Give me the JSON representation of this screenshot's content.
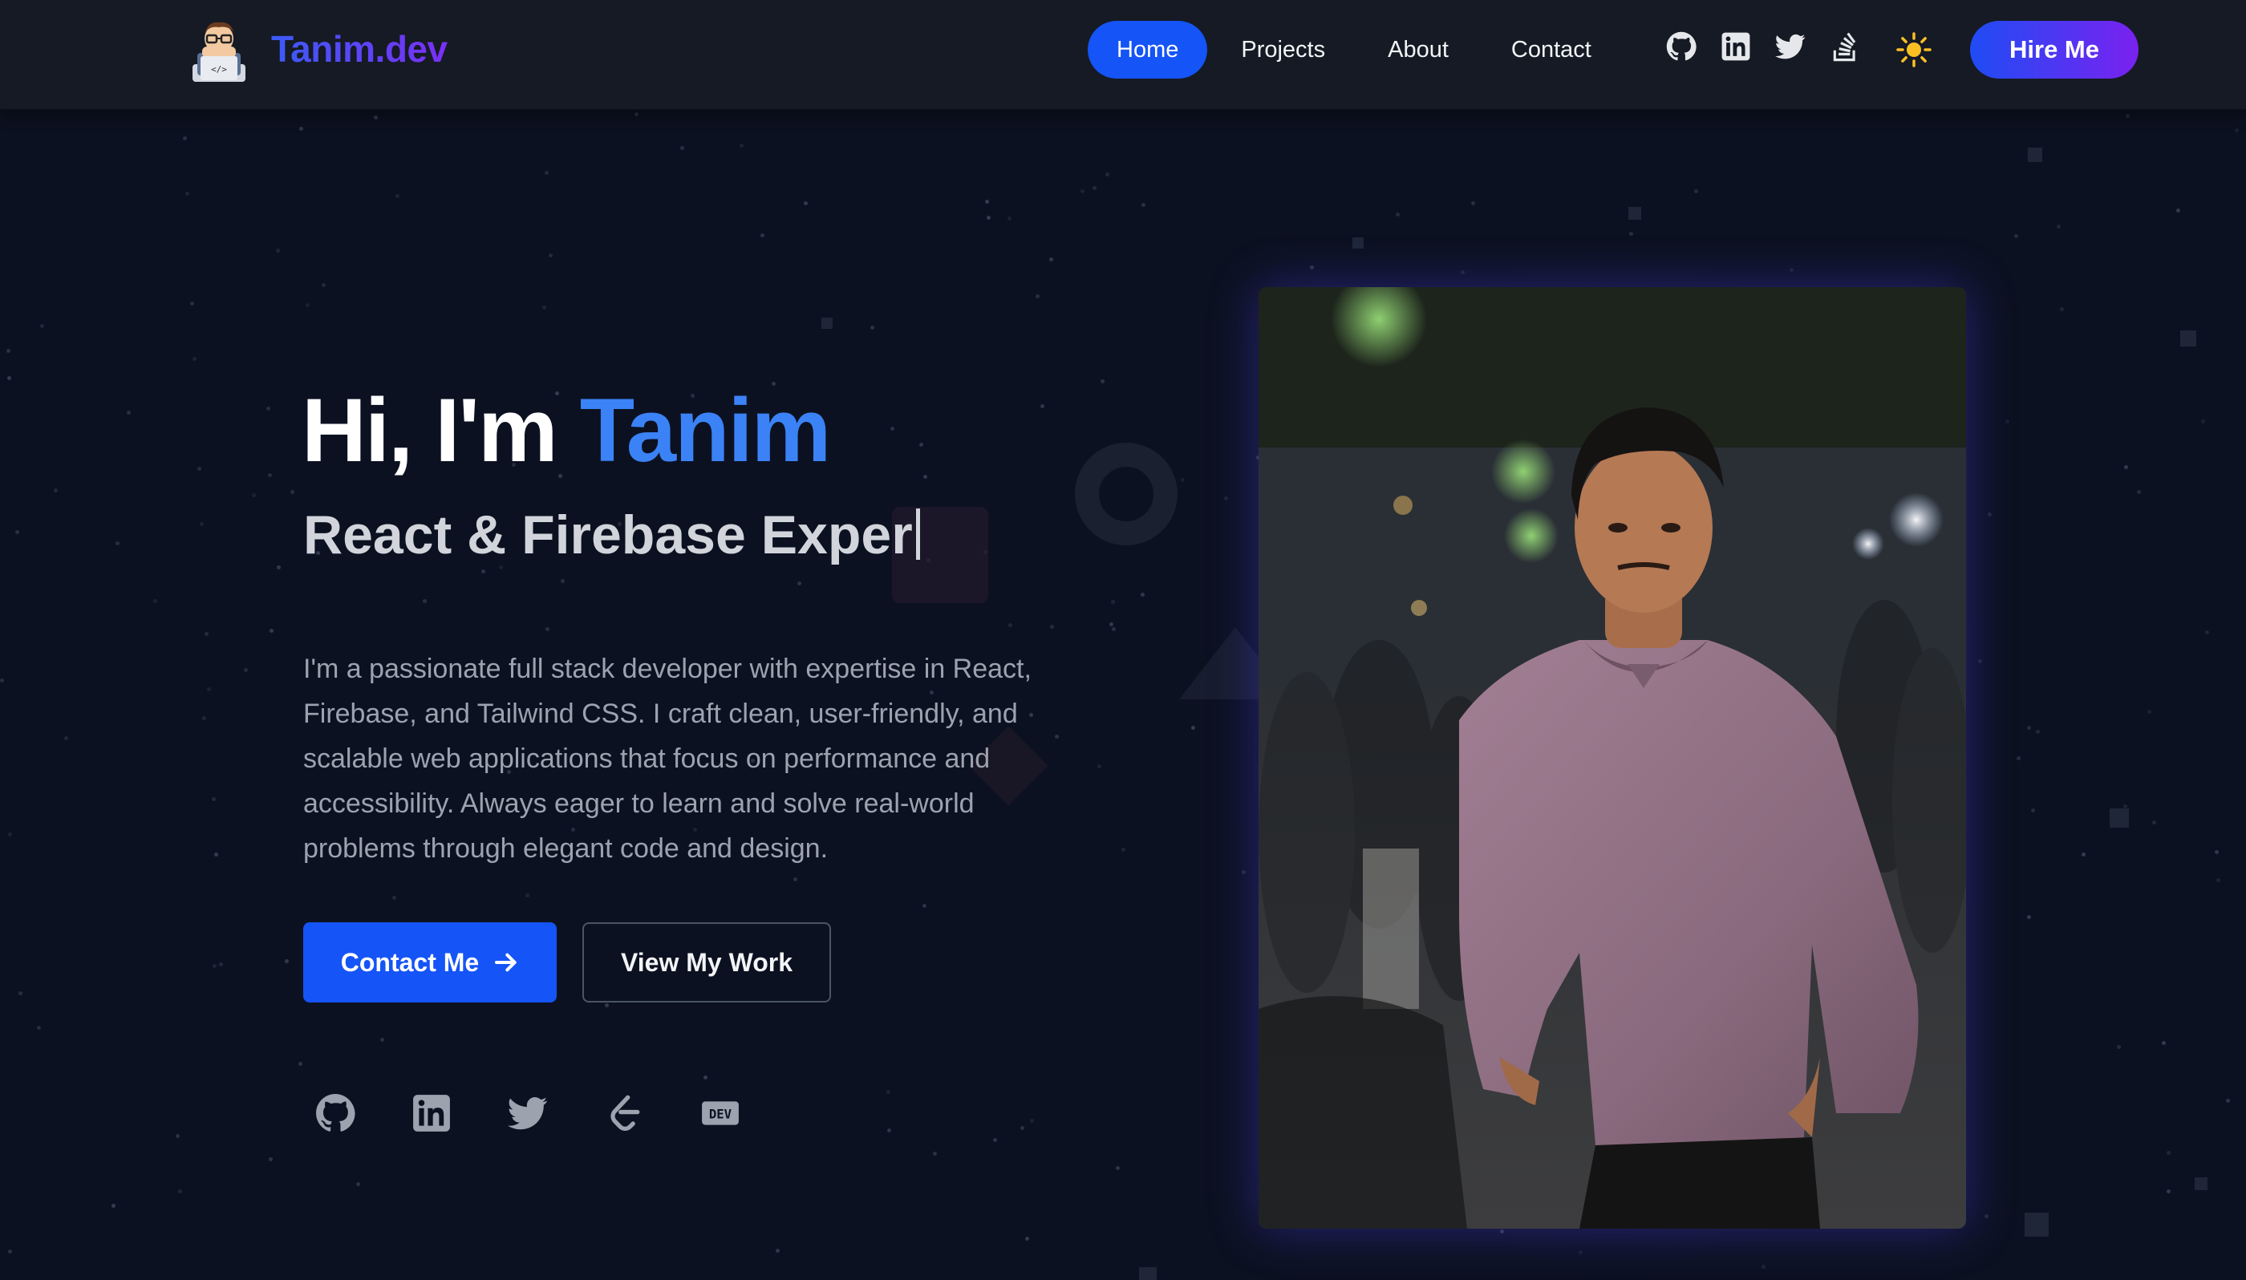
{
  "nav": {
    "logo_text": "Tanim.dev",
    "links": [
      {
        "label": "Home",
        "active": true
      },
      {
        "label": "Projects",
        "active": false
      },
      {
        "label": "About",
        "active": false
      },
      {
        "label": "Contact",
        "active": false
      }
    ],
    "icons": [
      "github-icon",
      "linkedin-icon",
      "twitter-icon",
      "stackoverflow-icon"
    ],
    "theme_toggle_icon": "sun-icon",
    "hire_label": "Hire Me"
  },
  "hero": {
    "greeting": "Hi, I'm ",
    "name": "Tanim",
    "subtitle": "React & Firebase Exper",
    "description": "I'm a passionate full stack developer with expertise in React, Firebase, and Tailwind CSS. I craft clean, user-friendly, and scalable web applications that focus on performance and accessibility. Always eager to learn and solve real-world problems through elegant code and design.",
    "primary_button": "Contact Me",
    "secondary_button": "View My Work",
    "socials": [
      "github-icon",
      "linkedin-icon",
      "twitter-icon",
      "leetcode-icon",
      "devto-icon"
    ],
    "devto_label": "DEV"
  },
  "colors": {
    "background": "#0c1121",
    "nav_bg": "#151a24",
    "accent_blue": "#1554f6",
    "name_blue": "#3b82f6",
    "gradient_purple": "#7a22f0"
  }
}
